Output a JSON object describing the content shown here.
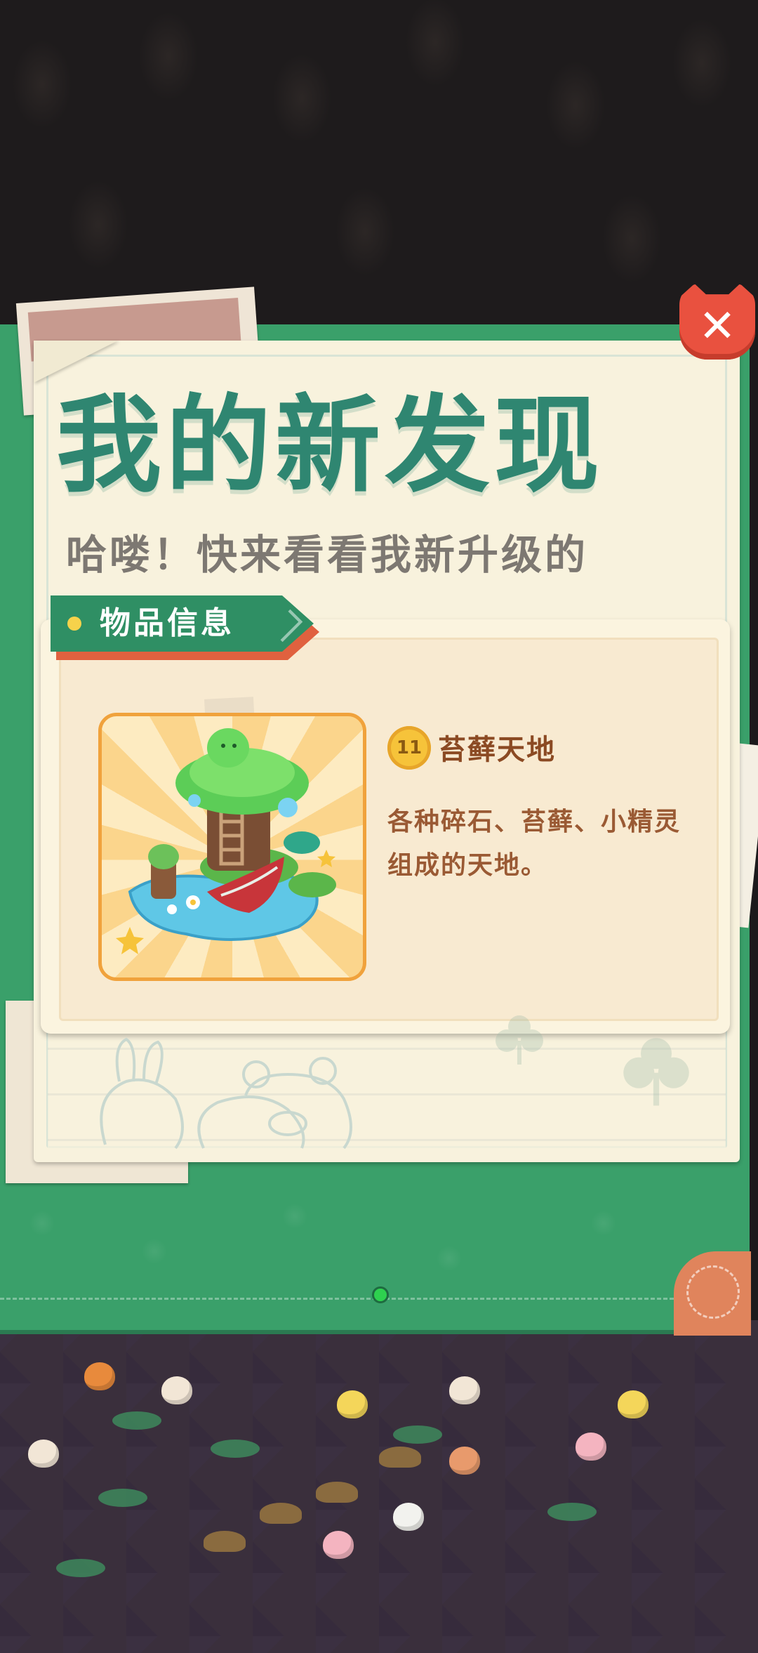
{
  "popup": {
    "title": "我的新发现",
    "subtitle": "哈喽！快来看看我新升级的",
    "close_label": "✕"
  },
  "info_card": {
    "tag_label": "物品信息",
    "item": {
      "level": "11",
      "name": "苔藓天地",
      "description": "各种碎石、苔藓、小精灵组成的天地。"
    }
  },
  "pagination": {
    "total": 1,
    "current": 1
  },
  "colors": {
    "modal_green": "#3aa06a",
    "title_green": "#2f8671",
    "close_red": "#e9513f",
    "item_name_brown": "#8b4a23"
  }
}
